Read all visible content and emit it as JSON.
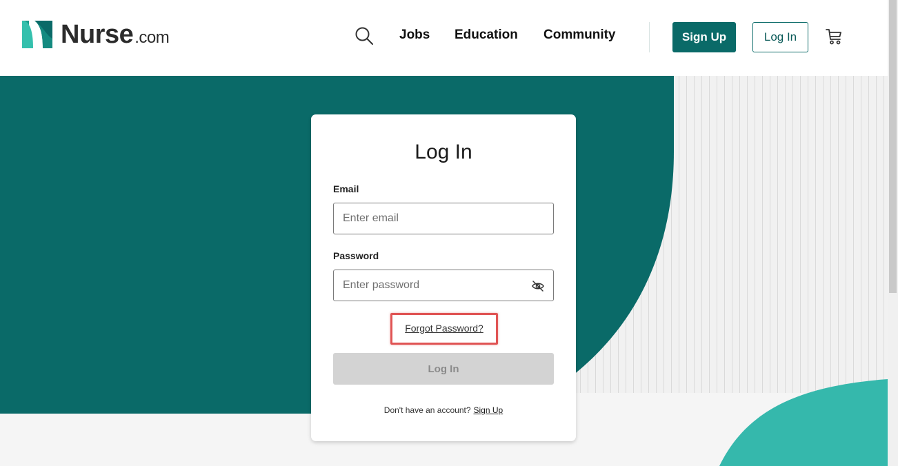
{
  "header": {
    "brand_name": "Nurse",
    "brand_suffix": ".com",
    "nav": {
      "jobs": "Jobs",
      "education": "Education",
      "community": "Community"
    },
    "sign_up_label": "Sign Up",
    "log_in_label": "Log In",
    "icons": {
      "search": "search-icon",
      "cart": "cart-icon"
    }
  },
  "login_card": {
    "title": "Log In",
    "email_label": "Email",
    "email_placeholder": "Enter email",
    "email_value": "",
    "password_label": "Password",
    "password_placeholder": "Enter password",
    "password_value": "",
    "forgot_password": "Forgot Password?",
    "submit_label": "Log In",
    "no_account_text": "Don't have an account?",
    "sign_up_link": "Sign Up"
  },
  "colors": {
    "brand_teal": "#0a6a68",
    "accent_teal": "#35b8ac",
    "highlight_red": "#e05454",
    "disabled_button": "#d3d3d3"
  }
}
